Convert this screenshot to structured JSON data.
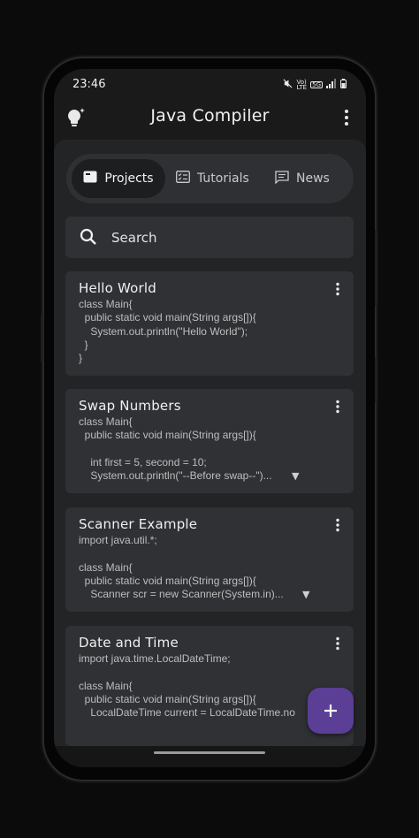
{
  "status_bar": {
    "time": "23:46",
    "network_label_1": "Vo)",
    "network_label_2": "LTE",
    "network_5g": "5G"
  },
  "app_bar": {
    "title": "Java Compiler",
    "left_icon": "lightbulb-icon",
    "right_icon": "more-vert-icon"
  },
  "tabs": [
    {
      "label": "Projects",
      "icon": "folder-card-icon",
      "active": true
    },
    {
      "label": "Tutorials",
      "icon": "checklist-icon",
      "active": false
    },
    {
      "label": "News",
      "icon": "message-icon",
      "active": false
    }
  ],
  "search": {
    "placeholder": "Search",
    "icon": "search-icon"
  },
  "projects": [
    {
      "title": "Hello World",
      "code": "class Main{\n  public static void main(String args[]){\n    System.out.println(\"Hello World\");\n  }\n}",
      "truncated": false
    },
    {
      "title": "Swap Numbers",
      "code": "class Main{\n  public static void main(String args[]){\n\n    int first = 5, second = 10;\n    System.out.println(\"--Before swap--\")...",
      "truncated": true
    },
    {
      "title": "Scanner Example",
      "code": "import java.util.*;\n\nclass Main{\n  public static void main(String args[]){\n    Scanner scr = new Scanner(System.in)...",
      "truncated": true
    },
    {
      "title": "Date and Time",
      "code": "import java.time.LocalDateTime;\n\nclass Main{\n  public static void main(String args[]){\n    LocalDateTime current = LocalDateTime.no",
      "truncated": false
    }
  ],
  "fab": {
    "icon": "plus-icon"
  },
  "colors": {
    "background": "#1a1a1b",
    "card": "#2f3134",
    "fab": "#5b3e96"
  }
}
